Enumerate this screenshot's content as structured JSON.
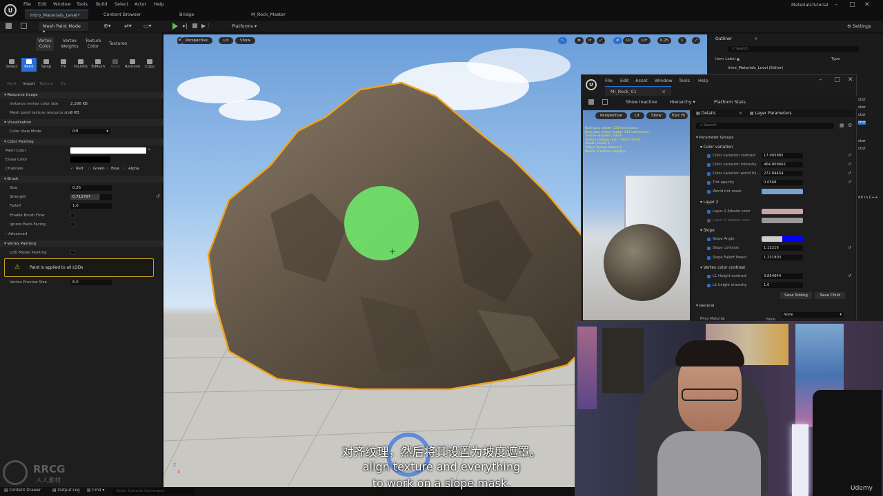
{
  "app": {
    "logo_text": "U",
    "menu": [
      "File",
      "Edit",
      "Window",
      "Tools",
      "Build",
      "Select",
      "Actor",
      "Help"
    ],
    "doc_tabs": [
      "Intro_Materials_Level•",
      "Content Browser",
      "Bridge",
      "M_Rock_Master"
    ],
    "project_name": "MaterialsTutorial",
    "accent": "#2a6fd3"
  },
  "toolbar": {
    "mode": "Mesh Paint Mode",
    "platforms": "Platforms",
    "settings": "Settings"
  },
  "mesh_paint": {
    "mode_tabs": [
      {
        "label": "Vertex Color",
        "active": true
      },
      {
        "label": "Vertex Weights",
        "active": false
      },
      {
        "label": "Texture Color",
        "active": false
      },
      {
        "label": "Textures",
        "active": false
      }
    ],
    "tools": [
      "Select",
      "Paint",
      "Swap",
      "Fill",
      "ToLODs",
      "ToMesh",
      "Save",
      "Remove",
      "Copy"
    ],
    "tools2": [
      "Paint",
      "Import",
      "Texture",
      "Fix"
    ],
    "resource_usage": {
      "header": "Resource Usage",
      "instance_label": "Instance vertex color size",
      "instance_value": "2,166 KB",
      "texture_label": "Mesh paint texture resource size",
      "texture_value": "0 KB"
    },
    "visualization": {
      "header": "Visualization",
      "color_view_label": "Color View Mode",
      "color_view_value": "Off"
    },
    "color_painting": {
      "header": "Color Painting",
      "paint_color": "Paint Color",
      "erase_color": "Erase Color",
      "channels_label": "Channels",
      "channels": [
        "Red",
        "Green",
        "Blue",
        "Alpha"
      ]
    },
    "brush": {
      "header": "Brush",
      "size_label": "Size",
      "size_value": "0.25",
      "strength_label": "Strength",
      "strength_value": "0.712797",
      "falloff_label": "Falloff",
      "falloff_value": "1.0",
      "flow_label": "Enable Brush Flow",
      "backface_label": "Ignore Back-Facing",
      "advanced": "Advanced"
    },
    "vertex_painting": {
      "header": "Vertex Painting",
      "lod_label": "LOD Model Painting",
      "warning": "Paint is applied to all LODs",
      "preview_label": "Vertex Preview Size",
      "preview_value": "6.0"
    }
  },
  "viewport": {
    "perspective": "Perspective",
    "lit": "Lit",
    "show": "Show",
    "grid_value": "10",
    "angle_value": "10°",
    "scale_value": "0.25",
    "cam_value": "1",
    "axis_z": "Z",
    "axis_x": "X"
  },
  "outliner": {
    "title": "Outliner",
    "search": "Search",
    "col_label": "Item Label ▲",
    "col_type": "Type",
    "row": "Intro_Materials_Level (Editor)",
    "side_items": [
      "ctor",
      "ctor",
      "ctor",
      "ctor",
      "ctor",
      "ctor",
      "ctor",
      "ctor",
      "ctor",
      "ctor",
      "ctor",
      "ctor"
    ],
    "edit_text": "dit in C++"
  },
  "material_editor": {
    "menu": [
      "File",
      "Edit",
      "Asset",
      "Window",
      "Tools",
      "Help"
    ],
    "tab": "MI_Rock_01",
    "show_inactive": "Show Inactive",
    "hierarchy": "Hierarchy",
    "platform_stats": "Platform Stats",
    "preview": {
      "perspective": "Perspective",
      "lit": "Lit",
      "show": "Show",
      "epic": "Epic Hi",
      "stats": [
        "Base pass shader: 221 instructions",
        "Base pass vertex shader: 134 instructions",
        "Texture samplers: 10/16",
        "Texture Lookups (Est.): VS(0), PS(14)",
        "Shader Count: 3",
        "Virtual Texture Stacks: 0",
        "Mobile: 0 texture samplers"
      ]
    },
    "details_tab": "Details",
    "layer_tab": "Layer Parameters",
    "search": "Search",
    "param_groups": "Parameter Groups",
    "groups": [
      {
        "name": "Color variation",
        "params": [
          {
            "label": "Color variation contrast",
            "value": "17.005985"
          },
          {
            "label": "Color variation intensity",
            "value": "464.809662"
          },
          {
            "label": "Color variation world tili...",
            "value": "272.84454"
          },
          {
            "label": "Tint opacity",
            "value": "0.0568"
          },
          {
            "label": "World tint mask",
            "value": "",
            "swatch": "#7aa0d2"
          }
        ]
      },
      {
        "name": "Layer 2",
        "params": [
          {
            "label": "Layer 2 Albedo color",
            "value": "",
            "swatch": "#c8a6a6"
          },
          {
            "label": "Layer 3 albedo color",
            "value": "",
            "swatch": "#9a9a9a"
          }
        ]
      },
      {
        "name": "Slope",
        "params": [
          {
            "label": "Slope Angle",
            "value": "",
            "swatch": "#0000ff"
          },
          {
            "label": "Slope contrast",
            "value": "1.12216"
          },
          {
            "label": "Slope Falloff Power",
            "value": "1.231803"
          }
        ]
      },
      {
        "name": "Vertex color contrast",
        "params": [
          {
            "label": "L1 Height contrast",
            "value": "3.854644"
          },
          {
            "label": "L1 height intensity",
            "value": "1.0"
          }
        ]
      }
    ],
    "save_sibling": "Save Sibling",
    "save_child": "Save Child",
    "general": "General",
    "phys_label": "Phys Material",
    "phys_value": "None",
    "none_label": "None"
  },
  "statusbar": {
    "content_drawer": "Content Drawer",
    "output_log": "Output Log",
    "cmd": "Cmd",
    "console": "Enter Console Command"
  },
  "subtitles": {
    "chinese": "对齐纹理，然后将其设置为坡度遮罩。",
    "line1": "align texture and everything",
    "line2": "to work on a slope mask."
  },
  "watermark": {
    "brand": "RRCG",
    "sub": "人人素材",
    "udemy": "Udemy"
  }
}
